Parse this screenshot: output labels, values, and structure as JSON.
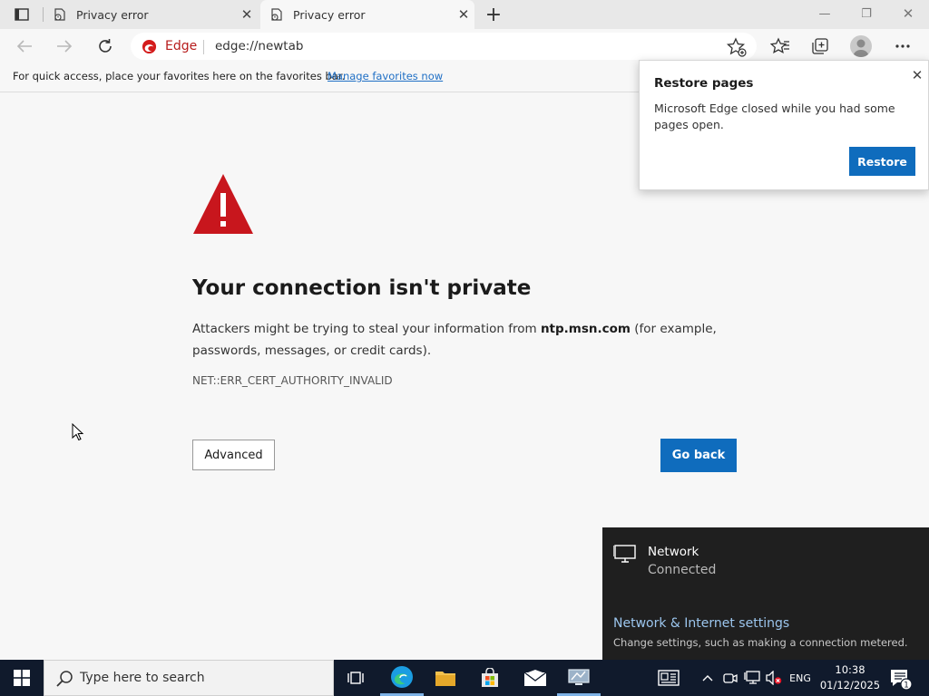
{
  "browser": {
    "tabs": [
      {
        "title": "Privacy error",
        "active": false
      },
      {
        "title": "Privacy error",
        "active": true
      }
    ],
    "address": {
      "brand_label": "Edge",
      "url": "edge://newtab"
    },
    "favorites_bar": {
      "message": "For quick access, place your favorites here on the favorites bar.",
      "link": "Manage favorites now"
    }
  },
  "error_page": {
    "heading": "Your connection isn't private",
    "desc_before": "Attackers might be trying to steal your information from ",
    "desc_domain": "ntp.msn.com",
    "desc_after": " (for example, passwords, messages, or credit cards).",
    "error_code": "NET::ERR_CERT_AUTHORITY_INVALID",
    "advanced_label": "Advanced",
    "go_back_label": "Go back"
  },
  "restore_popup": {
    "title": "Restore pages",
    "message": "Microsoft Edge closed while you had some pages open.",
    "button": "Restore"
  },
  "network_flyout": {
    "name": "Network",
    "status": "Connected",
    "settings_link": "Network & Internet settings",
    "settings_desc": "Change settings, such as making a connection metered."
  },
  "taskbar": {
    "search_placeholder": "Type here to search",
    "language": "ENG",
    "time": "10:38",
    "date": "01/12/2025",
    "notification_count": "1"
  },
  "colors": {
    "accent": "#0f6cbd",
    "taskbar": "#101a2c",
    "warning": "#c8161d"
  }
}
